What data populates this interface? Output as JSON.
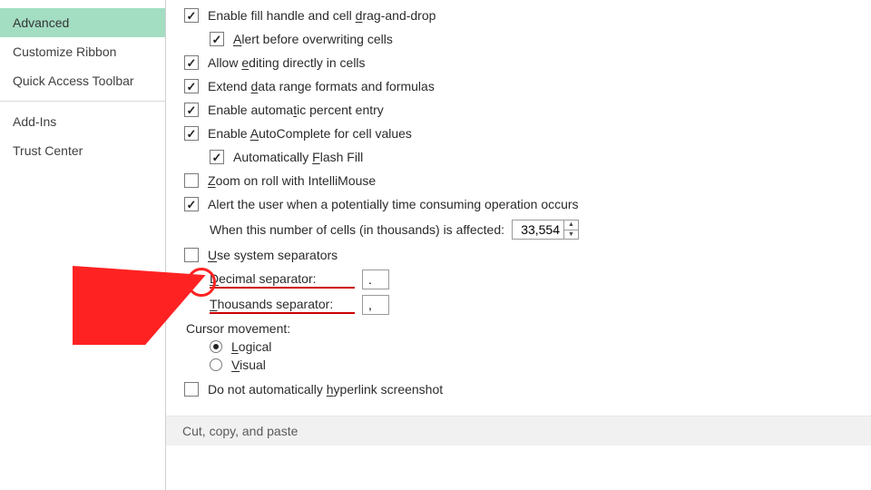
{
  "sidebar": {
    "items": [
      {
        "label": "Advanced",
        "selected": true
      },
      {
        "label": "Customize Ribbon",
        "selected": false
      },
      {
        "label": "Quick Access Toolbar",
        "selected": false
      }
    ],
    "items2": [
      {
        "label": "Add-Ins"
      },
      {
        "label": "Trust Center"
      }
    ]
  },
  "options": {
    "fillHandle": {
      "label_pre": "Enable fill handle and cell ",
      "u": "d",
      "rest": "rag-and-drop",
      "checked": true
    },
    "alertOverwrite": {
      "u": "A",
      "rest": "lert before overwriting cells",
      "checked": true
    },
    "allowEditing": {
      "pre": "Allow ",
      "u": "e",
      "rest": "diting directly in cells",
      "checked": true
    },
    "extendData": {
      "pre": "Extend ",
      "u": "d",
      "rest": "ata range formats and formulas",
      "checked": true
    },
    "percentEntry": {
      "pre": "Enable automa",
      "u": "t",
      "rest": "ic percent entry",
      "checked": true
    },
    "autoComplete": {
      "pre": "Enable ",
      "u": "A",
      "rest": "utoComplete for cell values",
      "checked": true
    },
    "flashFill": {
      "pre": "Automatically ",
      "u": "F",
      "rest": "lash Fill",
      "checked": true
    },
    "zoomRoll": {
      "u": "Z",
      "rest": "oom on roll with IntelliMouse",
      "checked": false
    },
    "alertTime": {
      "label": "Alert the user when a potentially time consuming operation occurs",
      "checked": true
    },
    "thresholdLabel": "When this number of cells (in thousands) is affected:",
    "thresholdValue": "33,554",
    "useSysSep": {
      "u": "U",
      "rest": "se system separators",
      "checked": false
    },
    "decimalSep": {
      "u": "D",
      "rest": "ecimal separator:",
      "value": "."
    },
    "thousandsSep": {
      "u": "T",
      "rest": "housands separator:",
      "value": ","
    },
    "cursorHeader": "Cursor movement:",
    "logical": {
      "u": "L",
      "rest": "ogical",
      "selected": true
    },
    "visual": {
      "u": "V",
      "rest": "isual",
      "selected": false
    },
    "hyperlink": {
      "pre": "Do not automatically ",
      "u": "h",
      "rest": "yperlink screenshot",
      "checked": false
    }
  },
  "sectionFooter": "Cut, copy, and paste"
}
